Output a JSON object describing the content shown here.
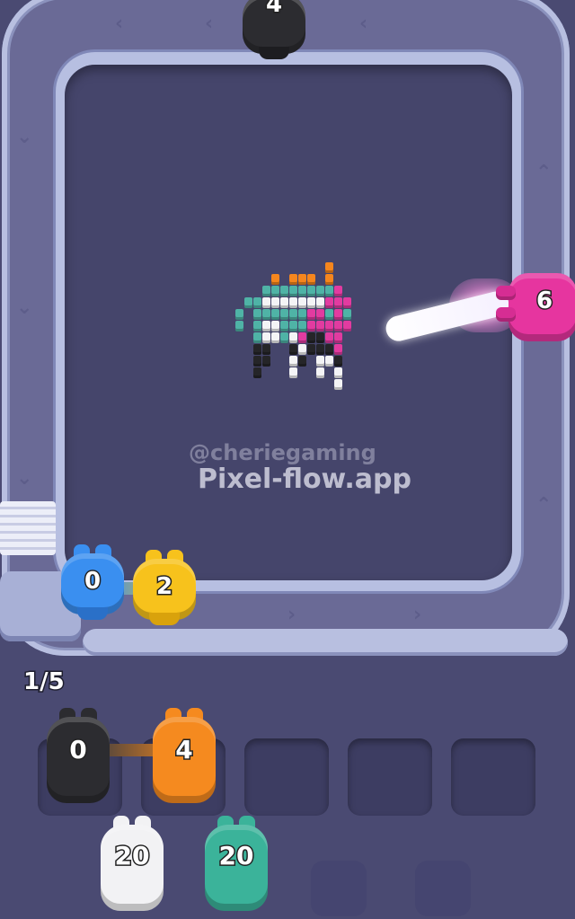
{
  "watermark": {
    "handle": "@cheriegaming",
    "site": "Pixel-flow.app"
  },
  "progress_counter": "1/5",
  "colors": {
    "blue": "#3a8ff0",
    "yellow": "#f7c21c",
    "black": "#2c2c30",
    "orange": "#f58a1f",
    "white": "#f2f2f4",
    "teal": "#3bb39a",
    "magenta": "#e6359f",
    "board": "#45456b"
  },
  "track_shooters": [
    {
      "color": "black",
      "count": "4",
      "position": "top"
    },
    {
      "color": "magenta",
      "count": "6",
      "position": "right"
    },
    {
      "color": "blue",
      "count": "0",
      "position": "entry-left"
    },
    {
      "color": "yellow",
      "count": "2",
      "position": "entry-right"
    }
  ],
  "queue": [
    {
      "color": "black",
      "count": "0"
    },
    {
      "color": "orange",
      "count": "4"
    },
    {
      "color": "white",
      "count": "20"
    },
    {
      "color": "teal",
      "count": "20"
    }
  ],
  "queue_slots_total": 5,
  "pixel_art": {
    "palette": {
      "o": "#f5861d",
      "w": "#f4f4f6",
      "t": "#4fb3a6",
      "m": "#e23ba0",
      "k": "#252528"
    },
    "rows": [
      "..........o...",
      "....o.ooo.o...",
      "...ttttttttm...",
      ".ttwwwwwwwmmm..",
      "t.ttttttmmtmt..",
      "t.twwtttmmmmm..",
      "..twwtwmkkmm...",
      "..kk..kwkkkm...",
      "..kk..wk.wwk...",
      "..k...w..w.w...",
      "...........w..."
    ]
  }
}
